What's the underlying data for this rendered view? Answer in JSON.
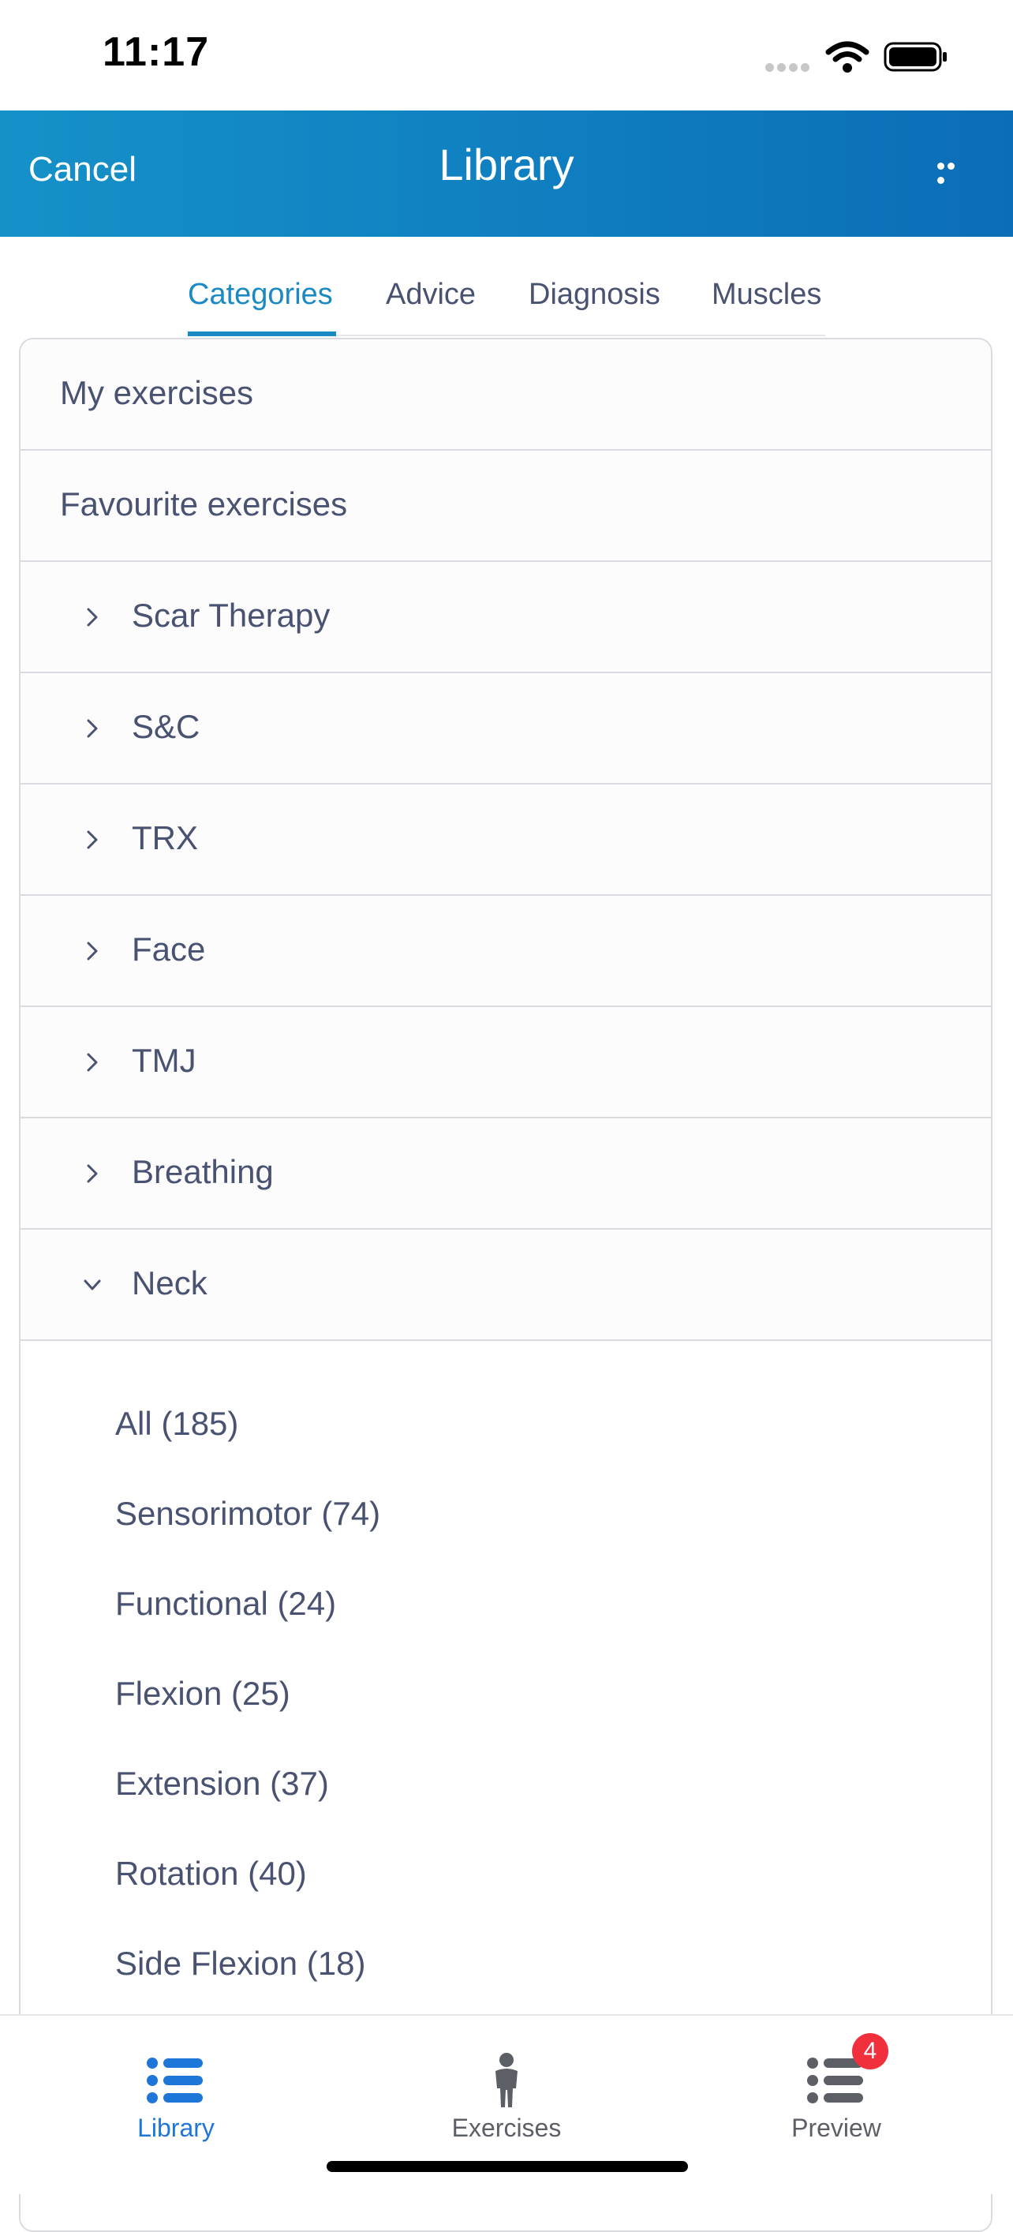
{
  "status": {
    "time": "11:17"
  },
  "nav": {
    "cancel_label": "Cancel",
    "title": "Library"
  },
  "tabs": [
    {
      "label": "Categories",
      "active": true
    },
    {
      "label": "Advice",
      "active": false
    },
    {
      "label": "Diagnosis",
      "active": false
    },
    {
      "label": "Muscles",
      "active": false
    }
  ],
  "list": {
    "plain_rows": [
      "My exercises",
      "Favourite exercises"
    ],
    "categories": [
      {
        "label": "Scar Therapy",
        "expanded": false
      },
      {
        "label": "S&C",
        "expanded": false
      },
      {
        "label": "TRX",
        "expanded": false
      },
      {
        "label": "Face",
        "expanded": false
      },
      {
        "label": "TMJ",
        "expanded": false
      },
      {
        "label": "Breathing",
        "expanded": false
      },
      {
        "label": "Neck",
        "expanded": true
      }
    ],
    "neck_subcategories": [
      "All (185)",
      "Sensorimotor (74)",
      "Functional (24)",
      "Flexion (25)",
      "Extension (37)",
      "Rotation (40)",
      "Side Flexion (18)"
    ]
  },
  "tab_bar": {
    "library_label": "Library",
    "exercises_label": "Exercises",
    "preview_label": "Preview",
    "preview_badge": "4"
  },
  "colors": {
    "nav_gradient_start": "#1691c8",
    "nav_gradient_end": "#0b6db6",
    "accent": "#1b8ac4",
    "tab_active": "#1e76d8",
    "badge": "#f0303c",
    "text": "#4a5272"
  },
  "icons": {
    "more": "ellipsis-icon",
    "chevron_right": "chevron-right-icon",
    "chevron_down": "chevron-down-icon",
    "library": "list-icon",
    "exercises": "person-icon",
    "preview": "list-icon"
  }
}
